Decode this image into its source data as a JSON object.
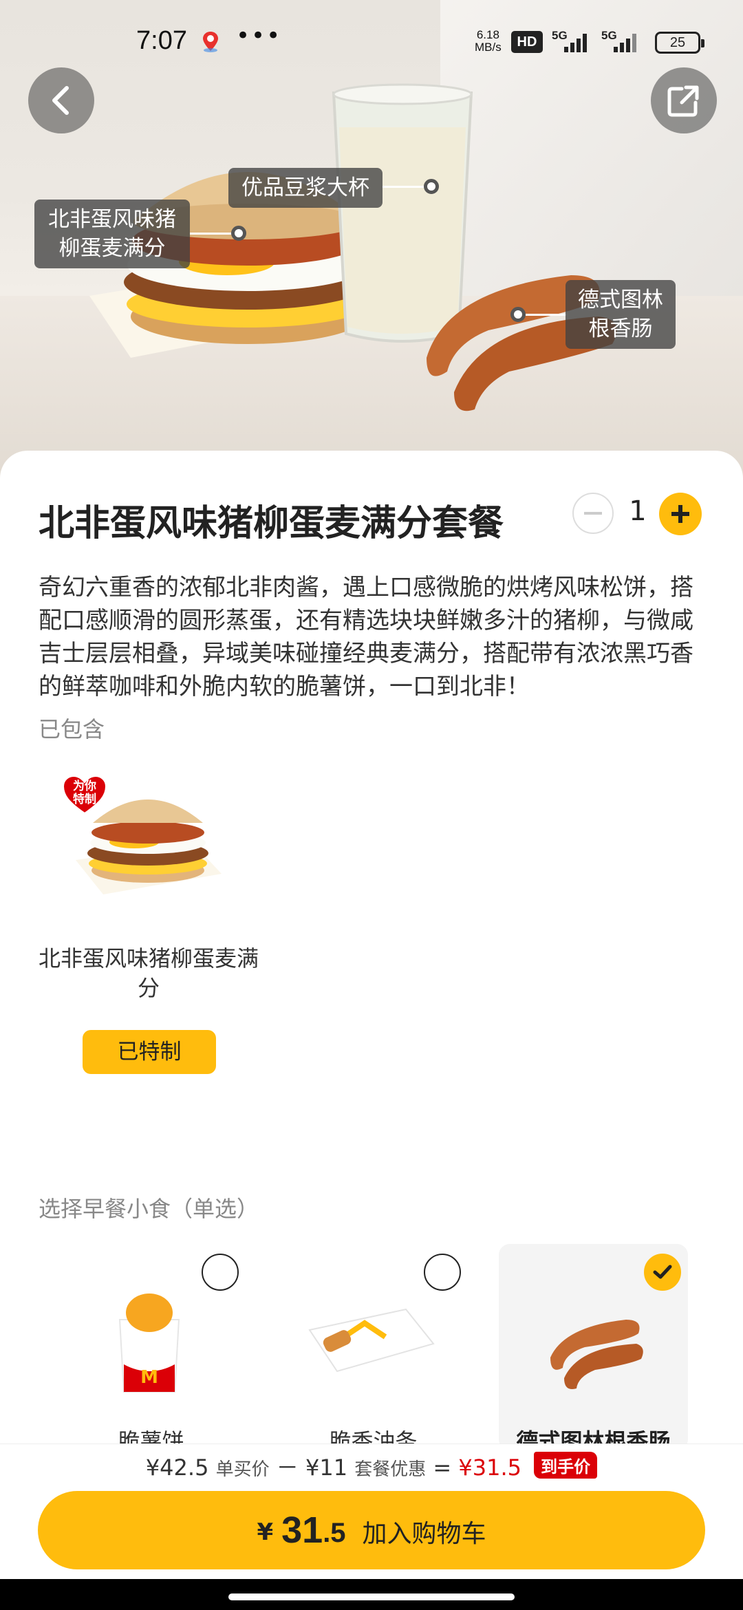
{
  "status_bar": {
    "time": "7:07",
    "net_speed_value": "6.18",
    "net_speed_unit": "MB/s",
    "hd_badge": "HD",
    "signal_1": "5G",
    "signal_2": "5G",
    "battery": "25"
  },
  "hero": {
    "tag_burger": "北非蛋风味猪柳蛋麦满分",
    "tag_soymilk": "优品豆浆大杯",
    "tag_sausage": "德式图林根香肠"
  },
  "product": {
    "title": "北非蛋风味猪柳蛋麦满分套餐",
    "quantity": "1",
    "description": "奇幻六重香的浓郁北非肉酱，遇上口感微脆的烘烤风味松饼，搭配口感顺滑的圆形蒸蛋，还有精选块块鲜嫩多汁的猪柳，与微咸吉士层层相叠，异域美味碰撞经典麦满分，搭配带有浓浓黑巧香的鲜萃咖啡和外脆内软的脆薯饼，一口到北非！"
  },
  "included": {
    "label": "已包含",
    "item_badge": "为你特制",
    "item_name": "北非蛋风味猪柳蛋麦满分",
    "button": "已特制"
  },
  "snack_select": {
    "label": "选择早餐小食（单选）",
    "options": [
      {
        "name": "脆薯饼",
        "selected": false
      },
      {
        "name": "脆香油条",
        "selected": false
      },
      {
        "name": "德式图林根香肠",
        "selected": true
      }
    ]
  },
  "price": {
    "single_price": "¥42.5",
    "single_label": "单买价",
    "minus": "－",
    "discount": "¥11",
    "discount_label": "套餐优惠",
    "equals": "=",
    "final": "¥31.5",
    "final_badge": "到手价"
  },
  "cart": {
    "currency": "¥",
    "price_int": "31",
    "price_dec": ".5",
    "label": "加入购物车"
  },
  "colors": {
    "accent": "#ffbc0d",
    "red": "#db0007"
  }
}
